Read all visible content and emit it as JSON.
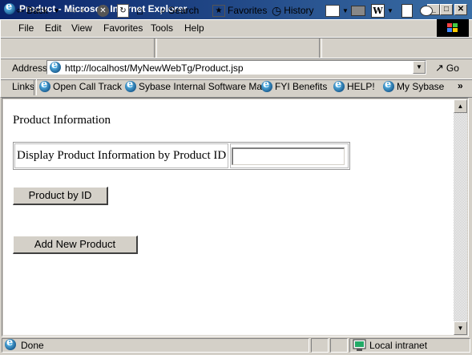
{
  "window": {
    "title": "Product - Microsoft Internet Explorer"
  },
  "menu": [
    "File",
    "Edit",
    "View",
    "Favorites",
    "Tools",
    "Help"
  ],
  "toolbar": {
    "back": "Back",
    "search": "Search",
    "favorites": "Favorites",
    "history": "History"
  },
  "address": {
    "label": "Address",
    "url": "http://localhost/MyNewWebTg/Product.jsp",
    "go": "Go"
  },
  "links": {
    "label": "Links",
    "items": [
      "Open Call Track",
      "Sybase Internal Software Mall",
      "FYI Benefits",
      "HELP!",
      "My Sybase"
    ]
  },
  "page": {
    "heading": "Product Information",
    "pid_label": "Display Product Information by Product ID",
    "pid_value": "",
    "btn_product_by_id": "Product by ID",
    "btn_add_product": "Add New Product"
  },
  "status": {
    "text": "Done",
    "zone": "Local intranet"
  },
  "icons": [
    "ie-page-icon",
    "minimize-icon",
    "maximize-icon",
    "close-icon",
    "windows-logo-icon",
    "back-arrow-icon",
    "forward-arrow-icon",
    "stop-icon",
    "refresh-icon",
    "home-icon",
    "search-icon",
    "favorites-icon",
    "history-icon",
    "mail-icon",
    "print-icon",
    "edit-icon",
    "discuss-icon",
    "messenger-icon",
    "go-arrow-icon",
    "chevron-right-icon",
    "globe-icon"
  ],
  "colors": {
    "titlebar_start": "#0a246a",
    "titlebar_end": "#3a6ea5",
    "chrome": "#d4d0c8"
  }
}
